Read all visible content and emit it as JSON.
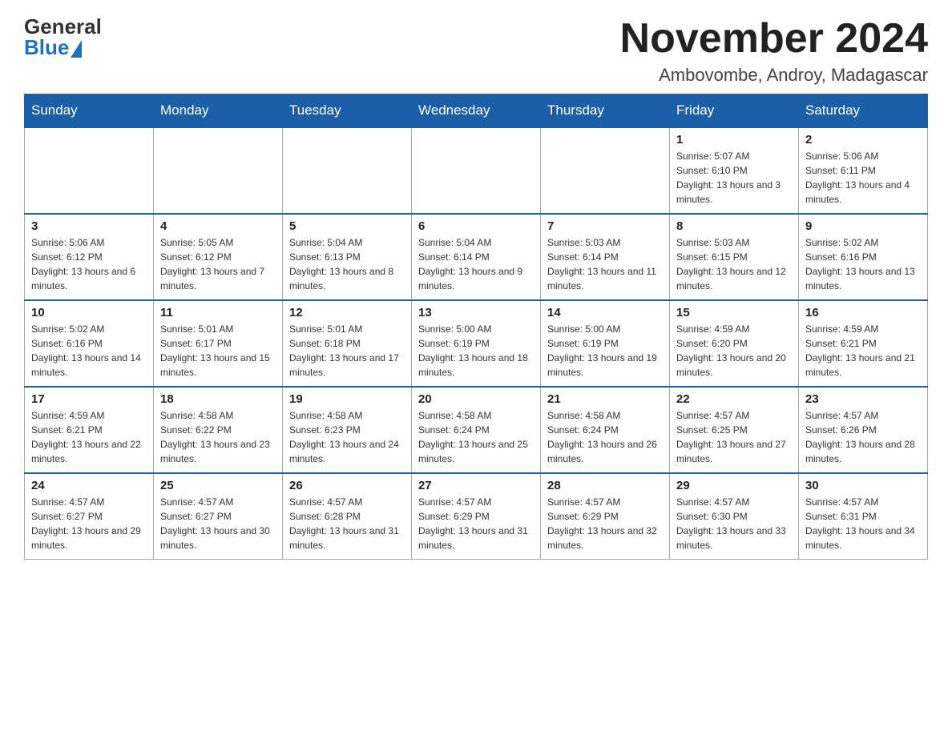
{
  "header": {
    "logo_general": "General",
    "logo_blue": "Blue",
    "month_title": "November 2024",
    "location": "Ambovombe, Androy, Madagascar"
  },
  "days_of_week": [
    "Sunday",
    "Monday",
    "Tuesday",
    "Wednesday",
    "Thursday",
    "Friday",
    "Saturday"
  ],
  "weeks": [
    [
      {
        "day": "",
        "info": ""
      },
      {
        "day": "",
        "info": ""
      },
      {
        "day": "",
        "info": ""
      },
      {
        "day": "",
        "info": ""
      },
      {
        "day": "",
        "info": ""
      },
      {
        "day": "1",
        "info": "Sunrise: 5:07 AM\nSunset: 6:10 PM\nDaylight: 13 hours and 3 minutes."
      },
      {
        "day": "2",
        "info": "Sunrise: 5:06 AM\nSunset: 6:11 PM\nDaylight: 13 hours and 4 minutes."
      }
    ],
    [
      {
        "day": "3",
        "info": "Sunrise: 5:06 AM\nSunset: 6:12 PM\nDaylight: 13 hours and 6 minutes."
      },
      {
        "day": "4",
        "info": "Sunrise: 5:05 AM\nSunset: 6:12 PM\nDaylight: 13 hours and 7 minutes."
      },
      {
        "day": "5",
        "info": "Sunrise: 5:04 AM\nSunset: 6:13 PM\nDaylight: 13 hours and 8 minutes."
      },
      {
        "day": "6",
        "info": "Sunrise: 5:04 AM\nSunset: 6:14 PM\nDaylight: 13 hours and 9 minutes."
      },
      {
        "day": "7",
        "info": "Sunrise: 5:03 AM\nSunset: 6:14 PM\nDaylight: 13 hours and 11 minutes."
      },
      {
        "day": "8",
        "info": "Sunrise: 5:03 AM\nSunset: 6:15 PM\nDaylight: 13 hours and 12 minutes."
      },
      {
        "day": "9",
        "info": "Sunrise: 5:02 AM\nSunset: 6:16 PM\nDaylight: 13 hours and 13 minutes."
      }
    ],
    [
      {
        "day": "10",
        "info": "Sunrise: 5:02 AM\nSunset: 6:16 PM\nDaylight: 13 hours and 14 minutes."
      },
      {
        "day": "11",
        "info": "Sunrise: 5:01 AM\nSunset: 6:17 PM\nDaylight: 13 hours and 15 minutes."
      },
      {
        "day": "12",
        "info": "Sunrise: 5:01 AM\nSunset: 6:18 PM\nDaylight: 13 hours and 17 minutes."
      },
      {
        "day": "13",
        "info": "Sunrise: 5:00 AM\nSunset: 6:19 PM\nDaylight: 13 hours and 18 minutes."
      },
      {
        "day": "14",
        "info": "Sunrise: 5:00 AM\nSunset: 6:19 PM\nDaylight: 13 hours and 19 minutes."
      },
      {
        "day": "15",
        "info": "Sunrise: 4:59 AM\nSunset: 6:20 PM\nDaylight: 13 hours and 20 minutes."
      },
      {
        "day": "16",
        "info": "Sunrise: 4:59 AM\nSunset: 6:21 PM\nDaylight: 13 hours and 21 minutes."
      }
    ],
    [
      {
        "day": "17",
        "info": "Sunrise: 4:59 AM\nSunset: 6:21 PM\nDaylight: 13 hours and 22 minutes."
      },
      {
        "day": "18",
        "info": "Sunrise: 4:58 AM\nSunset: 6:22 PM\nDaylight: 13 hours and 23 minutes."
      },
      {
        "day": "19",
        "info": "Sunrise: 4:58 AM\nSunset: 6:23 PM\nDaylight: 13 hours and 24 minutes."
      },
      {
        "day": "20",
        "info": "Sunrise: 4:58 AM\nSunset: 6:24 PM\nDaylight: 13 hours and 25 minutes."
      },
      {
        "day": "21",
        "info": "Sunrise: 4:58 AM\nSunset: 6:24 PM\nDaylight: 13 hours and 26 minutes."
      },
      {
        "day": "22",
        "info": "Sunrise: 4:57 AM\nSunset: 6:25 PM\nDaylight: 13 hours and 27 minutes."
      },
      {
        "day": "23",
        "info": "Sunrise: 4:57 AM\nSunset: 6:26 PM\nDaylight: 13 hours and 28 minutes."
      }
    ],
    [
      {
        "day": "24",
        "info": "Sunrise: 4:57 AM\nSunset: 6:27 PM\nDaylight: 13 hours and 29 minutes."
      },
      {
        "day": "25",
        "info": "Sunrise: 4:57 AM\nSunset: 6:27 PM\nDaylight: 13 hours and 30 minutes."
      },
      {
        "day": "26",
        "info": "Sunrise: 4:57 AM\nSunset: 6:28 PM\nDaylight: 13 hours and 31 minutes."
      },
      {
        "day": "27",
        "info": "Sunrise: 4:57 AM\nSunset: 6:29 PM\nDaylight: 13 hours and 31 minutes."
      },
      {
        "day": "28",
        "info": "Sunrise: 4:57 AM\nSunset: 6:29 PM\nDaylight: 13 hours and 32 minutes."
      },
      {
        "day": "29",
        "info": "Sunrise: 4:57 AM\nSunset: 6:30 PM\nDaylight: 13 hours and 33 minutes."
      },
      {
        "day": "30",
        "info": "Sunrise: 4:57 AM\nSunset: 6:31 PM\nDaylight: 13 hours and 34 minutes."
      }
    ]
  ]
}
